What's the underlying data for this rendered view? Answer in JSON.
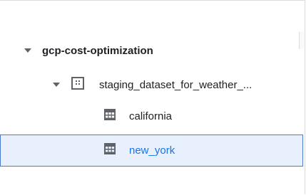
{
  "tree": {
    "project": {
      "name": "gcp-cost-optimization",
      "expand_icon": "caret-down-icon"
    },
    "dataset": {
      "name": "staging_dataset_for_weather_...",
      "expand_icon": "caret-down-icon",
      "type_icon": "dataset-icon"
    },
    "tables": [
      {
        "name": "california",
        "type_icon": "table-icon",
        "selected": false
      },
      {
        "name": "new_york",
        "type_icon": "table-icon",
        "selected": true
      }
    ]
  },
  "colors": {
    "selected_background": "#e8f0fe",
    "selected_border": "#4a7bd5",
    "selected_text": "#1a73e8",
    "icon_gray": "#5f6368",
    "text": "#202124"
  }
}
